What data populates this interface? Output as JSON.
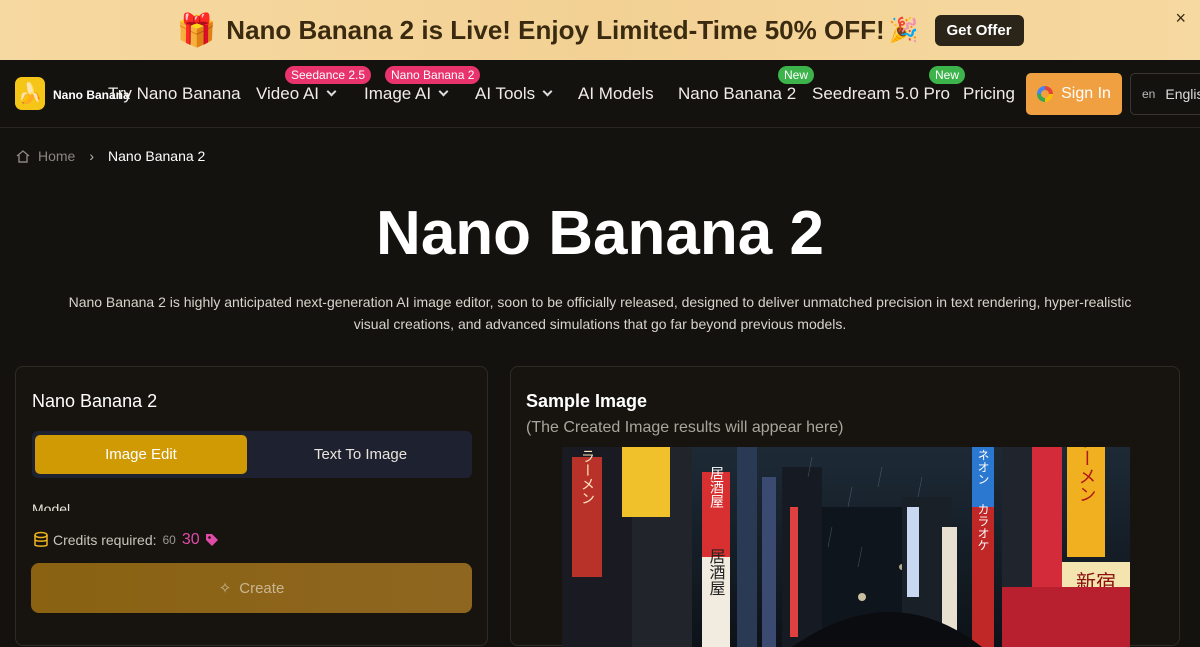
{
  "promo": {
    "text": "Nano Banana 2 is Live! Enjoy Limited-Time 50% OFF!",
    "button": "Get Offer",
    "close": "×"
  },
  "nav": {
    "brand": "Nano Banana",
    "items": [
      {
        "label": "Try Nano Banana"
      },
      {
        "label": "Video AI",
        "badge": "Seedance 2.5"
      },
      {
        "label": "Image AI",
        "badge": "Nano Banana 2"
      },
      {
        "label": "AI Tools"
      },
      {
        "label": "AI Models"
      },
      {
        "label": "Nano Banana 2",
        "badge": "New"
      },
      {
        "label": "Seedream 5.0 Pro",
        "badge": "New"
      },
      {
        "label": "Pricing"
      }
    ],
    "sign_in": "Sign In",
    "lang_code": "en",
    "lang_label": "Englis"
  },
  "breadcrumb": {
    "home": "Home",
    "current": "Nano Banana 2"
  },
  "hero": {
    "title": "Nano Banana 2",
    "description": "Nano Banana 2 is highly anticipated next-generation AI image editor, soon to be officially released, designed to deliver unmatched precision in text rendering, hyper-realistic visual creations, and advanced simulations that go far beyond previous models."
  },
  "editor": {
    "title": "Nano Banana 2",
    "tabs": [
      "Image Edit",
      "Text To Image"
    ],
    "model_label": "Model",
    "credits_label": "Credits required:",
    "credits_old": "60",
    "credits_new": "30",
    "create": "Create"
  },
  "sample": {
    "title": "Sample Image",
    "subtitle": "(The Created Image results will appear here)",
    "signs": [
      "ラーメン",
      "居酒屋",
      "カラオケ",
      "ネオン",
      "ラーメン",
      "新宿"
    ]
  }
}
